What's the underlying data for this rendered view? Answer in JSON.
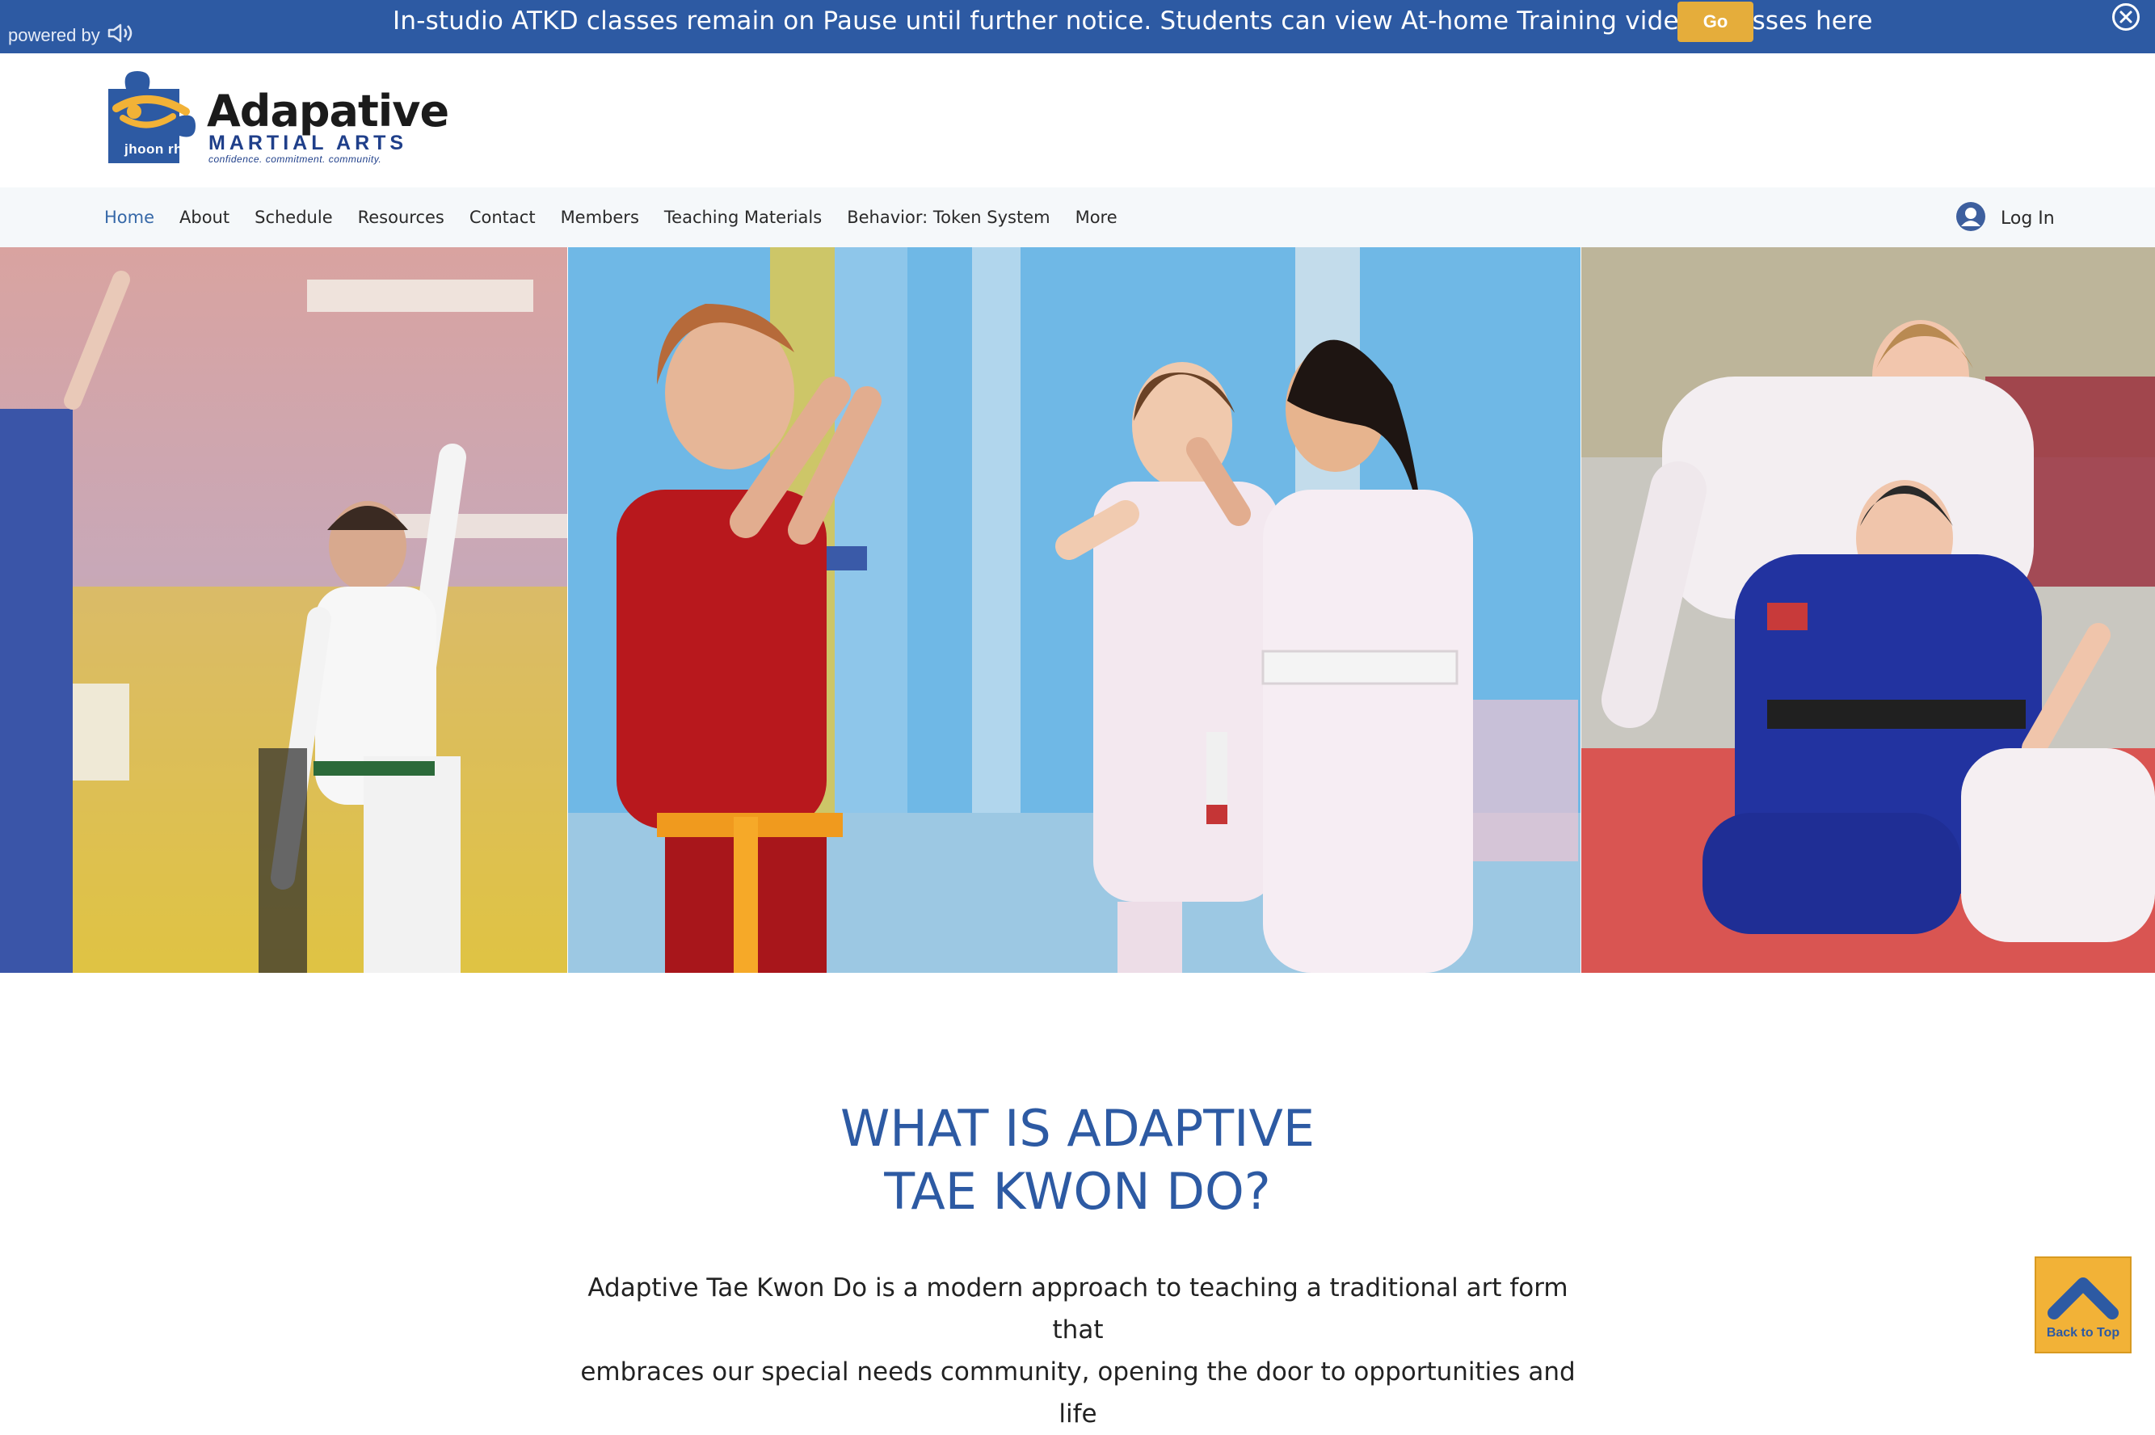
{
  "banner": {
    "powered_by": "powered by",
    "message": "In-studio ATKD classes remain on Pause until further notice. Students can view At-home Training videos classes here",
    "go_label": "Go",
    "bg_color": "#2d5aa3",
    "button_color": "#e5ad3b",
    "speaker_icon": "speaker-icon",
    "close_icon": "close-circle-icon"
  },
  "logo": {
    "word": "Adapative",
    "subtitle": "MARTIAL ARTS",
    "tagline": "confidence. commitment. community.",
    "badge_text": "jhoon rhee"
  },
  "nav": {
    "items": [
      {
        "label": "Home",
        "active": true
      },
      {
        "label": "About"
      },
      {
        "label": "Schedule"
      },
      {
        "label": "Resources"
      },
      {
        "label": "Contact"
      },
      {
        "label": "Members"
      },
      {
        "label": "Teaching Materials"
      },
      {
        "label": "Behavior: Token System"
      },
      {
        "label": "More"
      }
    ],
    "login_label": "Log In",
    "avatar_icon": "user-avatar-icon",
    "active_color": "#3668a8"
  },
  "hero": {
    "panels": [
      "hero-photo-left",
      "hero-photo-center",
      "hero-photo-right"
    ]
  },
  "content": {
    "headline_line1": "WHAT IS ADAPTIVE",
    "headline_line2": "TAE KWON DO?",
    "body_line1": "Adaptive Tae Kwon Do is a modern approach to teaching a traditional art form that",
    "body_line2": "embraces our special needs community, opening the door to opportunities and life",
    "headline_color": "#2d5aa3"
  },
  "back_to_top": {
    "label": "Back to Top",
    "icon": "chevron-up-icon",
    "bg_color": "#f2b237"
  }
}
